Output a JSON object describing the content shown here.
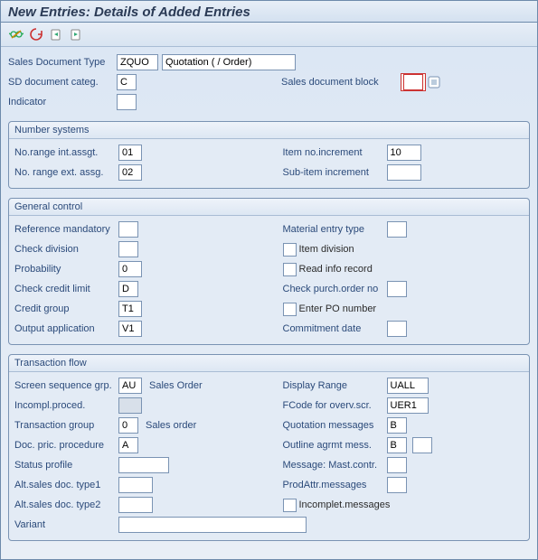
{
  "title": "New Entries: Details of Added Entries",
  "icons": {
    "glasses": "display-change",
    "refresh": "refresh",
    "new_left": "new-entry-left",
    "new_right": "new-entry-right"
  },
  "header": {
    "sales_doc_type_label": "Sales Document Type",
    "sales_doc_type_value": "ZQUO",
    "sales_doc_type_text": "Quotation ( / Order)",
    "sd_doc_categ_label": "SD document categ.",
    "sd_doc_categ_value": "C",
    "sales_block_label": "Sales document block",
    "sales_block_value": "",
    "indicator_label": "Indicator",
    "indicator_value": ""
  },
  "number_systems": {
    "title": "Number systems",
    "int_label": "No.range int.assgt.",
    "int_value": "01",
    "ext_label": "No. range ext. assg.",
    "ext_value": "02",
    "item_inc_label": "Item no.increment",
    "item_inc_value": "10",
    "sub_inc_label": "Sub-item increment",
    "sub_inc_value": ""
  },
  "general_control": {
    "title": "General control",
    "ref_label": "Reference mandatory",
    "ref_value": "",
    "check_div_label": "Check division",
    "check_div_value": "",
    "prob_label": "Probability",
    "prob_value": "0",
    "credit_label": "Check credit limit",
    "credit_value": "D",
    "credit_grp_label": "Credit group",
    "credit_grp_value": "T1",
    "output_label": "Output application",
    "output_value": "V1",
    "mat_entry_label": "Material entry type",
    "mat_entry_value": "",
    "item_div_label": "Item division",
    "read_info_label": "Read info record",
    "check_po_label": "Check purch.order no",
    "check_po_value": "",
    "enter_po_label": "Enter PO number",
    "commit_label": "Commitment  date",
    "commit_value": ""
  },
  "transaction_flow": {
    "title": "Transaction flow",
    "screen_seq_label": "Screen sequence grp.",
    "screen_seq_value": "AU",
    "screen_seq_text": "Sales Order",
    "incompl_label": "Incompl.proced.",
    "incompl_value": "",
    "trans_grp_label": "Transaction group",
    "trans_grp_value": "0",
    "trans_grp_text": "Sales order",
    "doc_pric_label": "Doc. pric. procedure",
    "doc_pric_value": "A",
    "status_label": "Status profile",
    "status_value": "",
    "alt1_label": "Alt.sales doc. type1",
    "alt1_value": "",
    "alt2_label": "Alt.sales doc. type2",
    "alt2_value": "",
    "variant_label": "Variant",
    "variant_value": "",
    "disp_label": "Display Range",
    "disp_value": "UALL",
    "fcode_label": "FCode for overv.scr.",
    "fcode_value": "UER1",
    "quot_label": "Quotation messages",
    "quot_value": "B",
    "outline_label": "Outline agrmt mess.",
    "outline_value": "B",
    "msg_mast_label": "Message: Mast.contr.",
    "msg_mast_value": "",
    "prodattr_label": "ProdAttr.messages",
    "prodattr_value": "",
    "incomplmsg_label": "Incomplet.messages"
  }
}
